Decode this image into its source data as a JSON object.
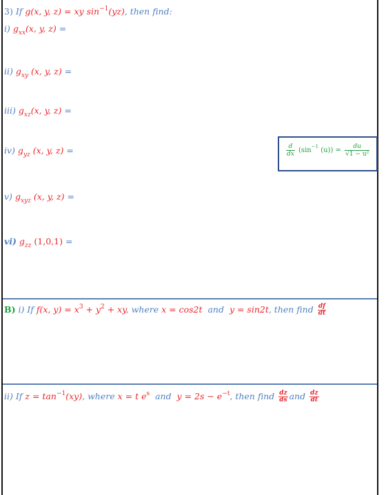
{
  "question3": {
    "label": "3)",
    "prefix": "If",
    "function": "g(x, y, z) = xy sin⁻¹(yz)",
    "func_name": "g(x, y, z) = ",
    "func_body": "xy sin",
    "func_exp": "−1",
    "func_arg": "(yz)",
    "suffix": ", then find:",
    "parts": [
      {
        "label": "i)",
        "func": "g",
        "sub": "xx",
        "args": "(x, y, z)",
        "eq": "="
      },
      {
        "label": "ii)",
        "func": "g",
        "sub": "xy",
        "args": " (x, y, z)",
        "eq": "="
      },
      {
        "label": "iii)",
        "func": "g",
        "sub": "xz",
        "args": "(x, y, z)",
        "eq": "="
      },
      {
        "label": "iv)",
        "func": "g",
        "sub": "yz",
        "args": " (x, y, z)",
        "eq": "="
      },
      {
        "label": "v)",
        "func": "g",
        "sub": "xyz",
        "args": " (x, y, z)",
        "eq": "="
      },
      {
        "label": "vi)",
        "func": "g",
        "sub": "zz",
        "args": " (1,0,1)",
        "eq": "="
      }
    ]
  },
  "hint_box": {
    "d": "d",
    "dx": "dx",
    "middle": "(sin",
    "exp": "−1",
    "arg": " (u)) =",
    "du": "du",
    "denominator": "√1 − u²"
  },
  "partB": {
    "label": "B)",
    "sublabel": "i)",
    "prefix": "If",
    "func": "f(x, y) = x",
    "exp1": "3",
    "mid1": " + y",
    "exp2": "2",
    "mid2": " + xy",
    "comma": ",",
    "where": "where",
    "xeq": "x = cos2t",
    "and": "and",
    "yeq": "y = sin2t",
    "then": ", then find",
    "num": "df",
    "den": "dt"
  },
  "partB2": {
    "label": "ii)",
    "prefix": "If",
    "zeq": "z = tan",
    "exp": "−1",
    "zarg": "(xy)",
    "comma": ",",
    "where": "where",
    "xeq": "x = t e",
    "xexp": "s",
    "and": "and",
    "yeq": "y = 2s − e",
    "yexp": "−t",
    "then": ", then find",
    "num1": "dz",
    "den1": "ds",
    "and2": "and",
    "num2": "dz",
    "den2": "dt"
  },
  "colors": {
    "text_blue": "#4f7fbf",
    "math_red": "#e8262b",
    "hint_green": "#1e9c3c",
    "box_border": "#2f4f8a",
    "rule_blue": "#5b80b2"
  }
}
